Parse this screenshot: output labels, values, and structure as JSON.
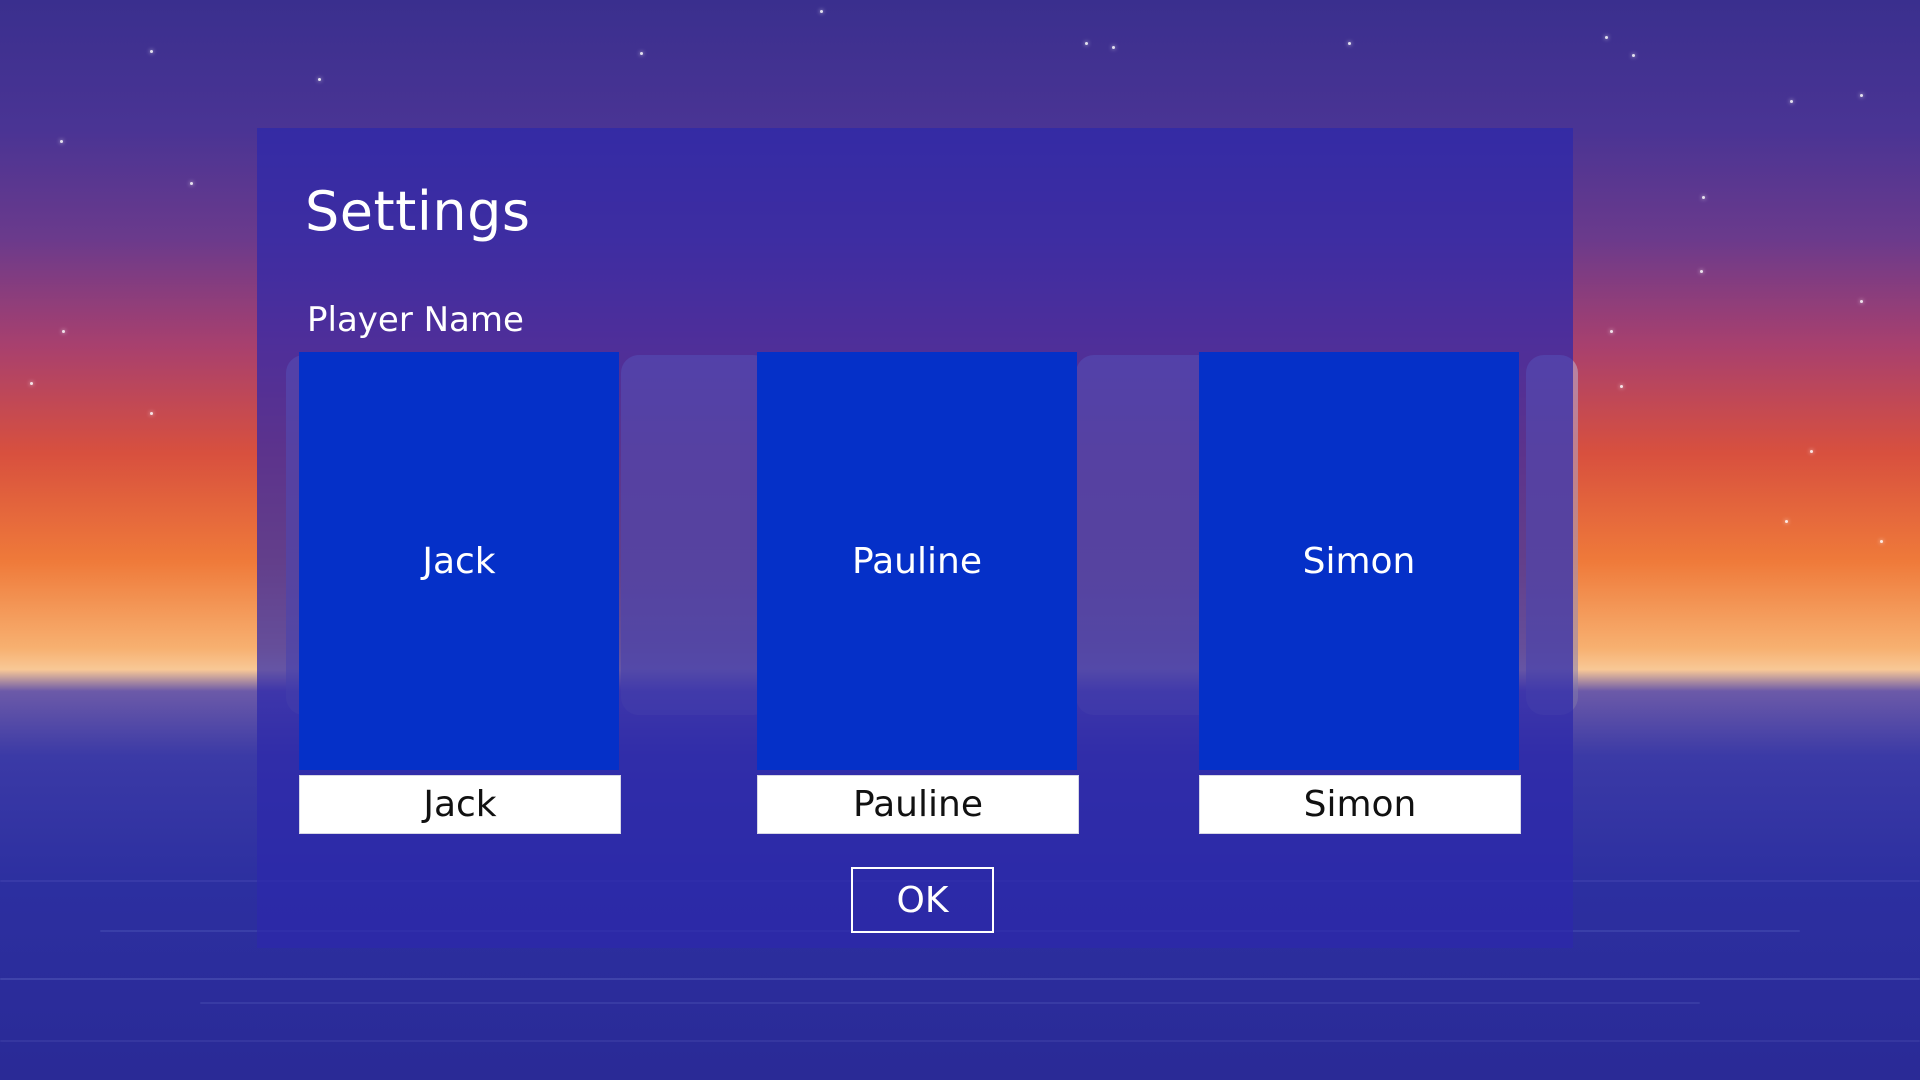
{
  "dialog": {
    "title": "Settings",
    "player_section_label": "Player Name"
  },
  "players": [
    {
      "tile_label": "Jack",
      "name_value": "Jack"
    },
    {
      "tile_label": "Pauline",
      "name_value": "Pauline"
    },
    {
      "tile_label": "Simon",
      "name_value": "Simon"
    }
  ],
  "actions": {
    "ok_label": "OK"
  },
  "colors": {
    "tile": "#0530c8",
    "dialog_background": "#2d28aa",
    "text": "#ffffff"
  }
}
